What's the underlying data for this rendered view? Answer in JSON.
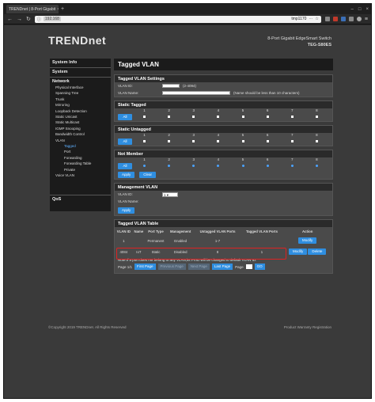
{
  "browser": {
    "tab_title": "TRENDnet | 8-Port Gigabit",
    "url_ip": "192.168",
    "url_right": "tmp1170"
  },
  "header": {
    "logo": "TRENDnet",
    "product_line": "8-Port Gigabit EdgeSmart Switch",
    "model": "TEG-S80ES"
  },
  "sidebar": {
    "system_info": "System Info",
    "system": "System",
    "network": "Network",
    "items": [
      {
        "label": "Physical Interface",
        "level": "l1"
      },
      {
        "label": "Spanning Tree",
        "level": "l1"
      },
      {
        "label": "Trunk",
        "level": "l1"
      },
      {
        "label": "Mirroring",
        "level": "l1"
      },
      {
        "label": "Loopback Detection",
        "level": "l1"
      },
      {
        "label": "Static Unicast",
        "level": "l1"
      },
      {
        "label": "Static Multicast",
        "level": "l1"
      },
      {
        "label": "IGMP Snooping",
        "level": "l1"
      },
      {
        "label": "Bandwidth Control",
        "level": "l1"
      },
      {
        "label": "VLAN",
        "level": "l1"
      },
      {
        "label": "Tagged",
        "level": "l3",
        "active": true
      },
      {
        "label": "Port",
        "level": "l3"
      },
      {
        "label": "Forwarding",
        "level": "l3"
      },
      {
        "label": "Forwarding Table",
        "level": "l3"
      },
      {
        "label": "Private",
        "level": "l3"
      },
      {
        "label": "Voice VLAN",
        "level": "l1"
      }
    ],
    "qos": "QoS"
  },
  "main": {
    "title": "Tagged VLAN",
    "settings": {
      "header": "Tagged VLAN Settings",
      "vlan_id_label": "VLAN ID:",
      "vlan_id_hint": "(2-4094)",
      "vlan_name_label": "VLAN Name:",
      "vlan_name_hint": "(Name should be less than 10 characters)"
    },
    "static_tagged": {
      "header": "Static Tagged",
      "all": "All"
    },
    "static_untagged": {
      "header": "Static Untagged",
      "all": "All"
    },
    "not_member": {
      "header": "Not Member",
      "all": "All"
    },
    "ports": [
      "1",
      "2",
      "3",
      "4",
      "5",
      "6",
      "7",
      "8"
    ],
    "apply": "Apply",
    "clear": "Clear",
    "mgmt": {
      "header": "Management VLAN",
      "vlan_id_label": "VLAN ID:",
      "vlan_id_value": "1",
      "vlan_name_label": "VLAN Name:",
      "apply": "Apply"
    },
    "table": {
      "header": "Tagged VLAN Table",
      "columns": [
        "VLAN ID",
        "Name",
        "Port Type",
        "Management",
        "Untagged VLAN Ports",
        "Tagged VLAN Ports",
        "Action"
      ],
      "row1": {
        "vlan_id": "1",
        "name": "",
        "type": "Permanent",
        "mgmt": "Enabled",
        "untagged": "1-7",
        "tagged": "",
        "modify": "Modify"
      },
      "row2": {
        "vlan_id": "4084",
        "name": "IoT",
        "type": "Static",
        "mgmt": "Disabled",
        "untagged": "8",
        "tagged": "1",
        "modify": "Modify",
        "delete": "Delete"
      }
    },
    "note": "Note:If a port does not belong to any VLAN,its PVID will be changed to default VLAN ID.",
    "pager": {
      "page_label": "Page 1/1",
      "first": "First Page",
      "prev": "Previous Page",
      "next": "Next Page",
      "last": "Last Page",
      "page": "Page",
      "go": "GO"
    }
  },
  "footer": {
    "copyright": "©Copyright 2019 TRENDnet. All Rights Reserved",
    "links": "Product Warranty Registration"
  },
  "colors": {
    "accent": "#2f8ee0",
    "highlight": "#dd2222",
    "panel": "#1b1b1b"
  }
}
